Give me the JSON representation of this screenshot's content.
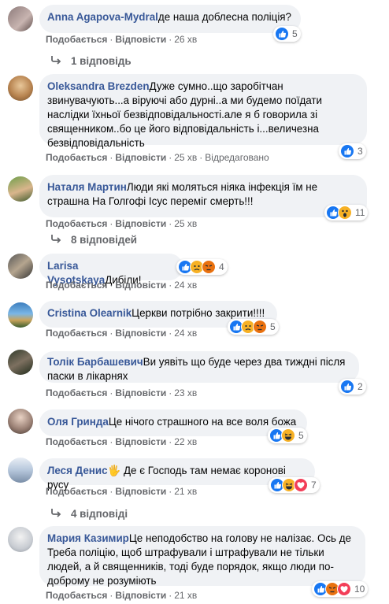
{
  "labels": {
    "like": "Подобається",
    "reply": "Відповісти",
    "edited": "Відредаговано",
    "dot": "·"
  },
  "comments": [
    {
      "author": "Anna Agapova-Mydral",
      "text": "де наша доблесна поліція?",
      "time": "26 хв",
      "reactions": [
        "like"
      ],
      "count": "5"
    },
    {
      "author": "Oleksandra Brezden",
      "text": "Дуже сумно..що заробітчан звинувачують...а віруючі або дурні..а ми будемо поїдати наслідки їхньої безвідповідальності.але я б говорила зі священником..бо це його відповідальність і...величезна безвідповідальність",
      "time": "25 хв",
      "edited": true,
      "reactions": [
        "like"
      ],
      "count": "3"
    },
    {
      "author": "Наталя Мартин",
      "text": "Люди які моляться ніяка інфекція їм не страшна На Голгофі Ісус переміг смерть!!!",
      "time": "25 хв",
      "reactions": [
        "like",
        "wow"
      ],
      "count": "11"
    },
    {
      "author": "Larisa Vysotskaya",
      "text": "Дибіли!",
      "time": "24 хв",
      "reactions": [
        "like",
        "sad",
        "angry"
      ],
      "count": "4"
    },
    {
      "author": "Cristina Olearnik",
      "text": "Церкви потрібно закрити!!!!",
      "time": "24 хв",
      "reactions": [
        "like",
        "sad",
        "angry"
      ],
      "count": "5"
    },
    {
      "author": "Толік Барбашевич",
      "text": "Ви уявіть що буде через два тиждні після паски в лікарнях",
      "time": "23 хв",
      "reactions": [
        "like"
      ],
      "count": "2"
    },
    {
      "author": "Оля Гринда",
      "text": "Це нічого страшного на все воля божа",
      "time": "22 хв",
      "reactions": [
        "like",
        "haha"
      ],
      "count": "5"
    },
    {
      "author": "Леся Денис",
      "text": "🖐 Де є Господь там немає коронові​русу",
      "time": "21 хв",
      "reactions": [
        "like",
        "haha",
        "love"
      ],
      "count": "7"
    },
    {
      "author": "Мария Казимир",
      "text": "Це неподобство на голову не налізає. Ось де Треба поліцію, щоб штрафували і штрафували не тільки людей, а й священників, тоді буде порядок, якщо люди по-доброму не розуміють",
      "time": "21 хв",
      "reactions": [
        "like",
        "angry",
        "love"
      ],
      "count": "10"
    }
  ],
  "replies": [
    {
      "label": "1 відповідь"
    },
    {
      "label": "8 відповідей"
    },
    {
      "label": "4 відповіді"
    }
  ],
  "colors": {
    "author": "#385898",
    "bubble": "#f0f2f5",
    "like": "#1877f2"
  }
}
